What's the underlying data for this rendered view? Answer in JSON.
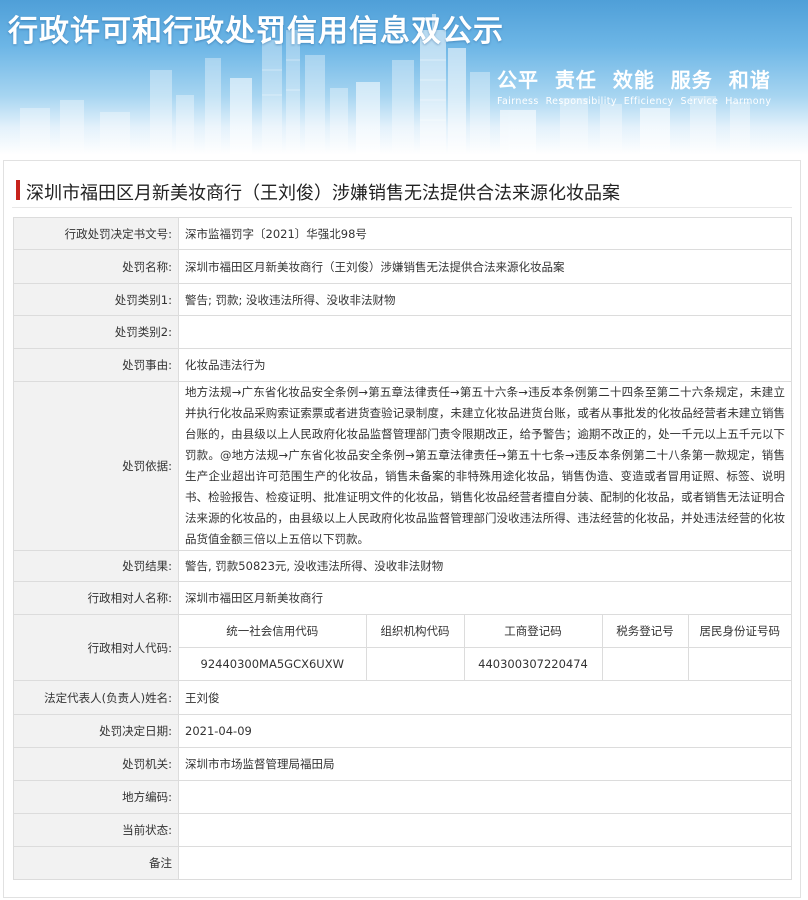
{
  "banner": {
    "title": "行政许可和行政处罚信用信息双公示",
    "slogan_cn": "公平  责任  效能  服务  和谐",
    "slogan_en": "Fairness  Responsibility  Efficiency  Service  Harmony"
  },
  "case_title": "深圳市福田区月新美妆商行（王刘俊）涉嫌销售无法提供合法来源化妆品案",
  "rows": {
    "decision_no": {
      "label": "行政处罚决定书文号:",
      "value": "深市监福罚字〔2021〕华强北98号"
    },
    "penalty_name": {
      "label": "处罚名称:",
      "value": "深圳市福田区月新美妆商行（王刘俊）涉嫌销售无法提供合法来源化妆品案"
    },
    "category1": {
      "label": "处罚类别1:",
      "value": "警告; 罚款; 没收违法所得、没收非法财物"
    },
    "category2": {
      "label": "处罚类别2:",
      "value": ""
    },
    "reason": {
      "label": "处罚事由:",
      "value": "化妆品违法行为"
    },
    "basis": {
      "label": "处罚依据:",
      "value": "地方法规→广东省化妆品安全条例→第五章法律责任→第五十六条→违反本条例第二十四条至第二十六条规定，未建立并执行化妆品采购索证索票或者进货查验记录制度，未建立化妆品进货台账，或者从事批发的化妆品经营者未建立销售台账的，由县级以上人民政府化妆品监督管理部门责令限期改正，给予警告；逾期不改正的，处一千元以上五千元以下罚款。@地方法规→广东省化妆品安全条例→第五章法律责任→第五十七条→违反本条例第二十八条第一款规定，销售生产企业超出许可范围生产的化妆品，销售未备案的非特殊用途化妆品，销售伪造、变造或者冒用证照、标签、说明书、检验报告、检疫证明、批准证明文件的化妆品，销售化妆品经营者擅自分装、配制的化妆品，或者销售无法证明合法来源的化妆品的，由县级以上人民政府化妆品监督管理部门没收违法所得、违法经营的化妆品，并处违法经营的化妆品货值金额三倍以上五倍以下罚款。"
    },
    "result": {
      "label": "处罚结果:",
      "value": "警告, 罚款50823元, 没收违法所得、没收非法财物"
    },
    "counterparty": {
      "label": "行政相对人名称:",
      "value": "深圳市福田区月新美妆商行"
    },
    "codes": {
      "label": "行政相对人代码:",
      "headers": [
        "统一社会信用代码",
        "组织机构代码",
        "工商登记码",
        "税务登记号",
        "居民身份证号码"
      ],
      "values": [
        "92440300MA5GCX6UXW",
        "",
        "440300307220474",
        "",
        ""
      ]
    },
    "legal_rep": {
      "label": "法定代表人(负责人)姓名:",
      "value": "王刘俊"
    },
    "decision_date": {
      "label": "处罚决定日期:",
      "value": "2021-04-09"
    },
    "authority": {
      "label": "处罚机关:",
      "value": "深圳市市场监督管理局福田局"
    },
    "local_code": {
      "label": "地方编码:",
      "value": ""
    },
    "status": {
      "label": "当前状态:",
      "value": ""
    },
    "remark": {
      "label": "备注",
      "value": ""
    }
  },
  "colors": {
    "accent_bar": "#c7231c",
    "label_bg": "#f2f2f2",
    "border": "#dcdcdc",
    "banner_blue": "#4f9fd8"
  }
}
